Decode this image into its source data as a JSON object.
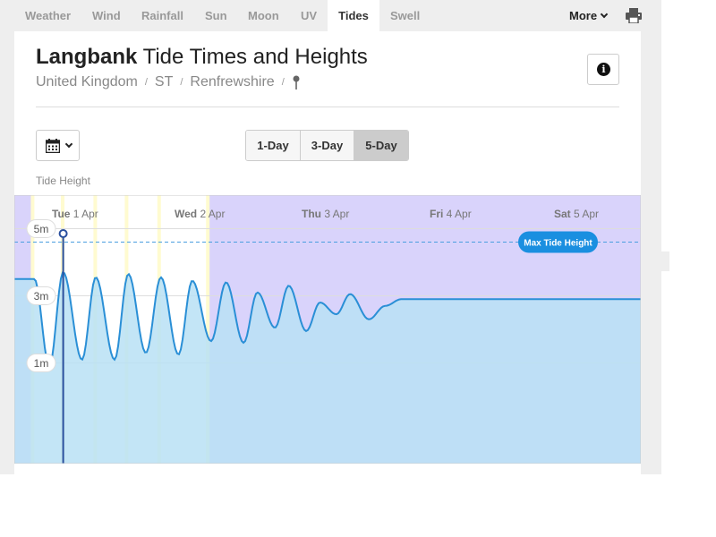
{
  "nav": {
    "tabs": [
      {
        "label": "Weather"
      },
      {
        "label": "Wind"
      },
      {
        "label": "Rainfall"
      },
      {
        "label": "Sun"
      },
      {
        "label": "Moon"
      },
      {
        "label": "UV"
      },
      {
        "label": "Tides",
        "active": true
      },
      {
        "label": "Swell"
      }
    ],
    "more_label": "More",
    "print_icon": "printer-icon"
  },
  "header": {
    "location": "Langbank",
    "title_rest": "Tide Times and Heights",
    "breadcrumb": [
      "United Kingdom",
      "ST",
      "Renfrewshire"
    ],
    "pin_icon": "map-pin-icon",
    "info_icon": "info-icon"
  },
  "controls": {
    "calendar_icon": "calendar-icon",
    "range_buttons": [
      {
        "label": "1-Day"
      },
      {
        "label": "3-Day"
      },
      {
        "label": "5-Day",
        "active": true
      }
    ]
  },
  "chart_label": "Tide Height",
  "chart_data": {
    "type": "area",
    "ylabel": "Tide Height",
    "unit": "m",
    "y_ticks": [
      "5m",
      "3m",
      "1m"
    ],
    "days": [
      {
        "weekday": "Tue",
        "date": "1 Apr"
      },
      {
        "weekday": "Wed",
        "date": "2 Apr"
      },
      {
        "weekday": "Thu",
        "date": "3 Apr"
      },
      {
        "weekday": "Fri",
        "date": "4 Apr"
      },
      {
        "weekday": "Sat",
        "date": "5 Apr"
      }
    ],
    "x_range_days": [
      -0.26,
      4.74
    ],
    "max_tide_label": "Max Tide Height",
    "max_tide_height": 4.6,
    "colors": {
      "water": "#b8e0f5",
      "line": "#2a8fd6",
      "night": "#d9d3fb",
      "twilight": "#fffbd0",
      "max_label": "#1a8fe0",
      "now_marker": "#2a4f9e"
    },
    "extremes": [
      {
        "t": -0.1,
        "h": 3.5
      },
      {
        "t": 0.02,
        "h": 0.9
      },
      {
        "t": 0.13,
        "h": 3.7
      },
      {
        "t": 0.28,
        "h": 1.1
      },
      {
        "t": 0.39,
        "h": 3.55
      },
      {
        "t": 0.54,
        "h": 1.1
      },
      {
        "t": 0.65,
        "h": 3.65
      },
      {
        "t": 0.79,
        "h": 1.3
      },
      {
        "t": 0.91,
        "h": 3.55
      },
      {
        "t": 1.05,
        "h": 1.25
      },
      {
        "t": 1.16,
        "h": 3.45
      },
      {
        "t": 1.31,
        "h": 1.65
      },
      {
        "t": 1.43,
        "h": 3.4
      },
      {
        "t": 1.57,
        "h": 1.6
      },
      {
        "t": 1.68,
        "h": 3.1
      },
      {
        "t": 1.82,
        "h": 2.05
      },
      {
        "t": 1.93,
        "h": 3.3
      },
      {
        "t": 2.07,
        "h": 1.95
      },
      {
        "t": 2.18,
        "h": 2.8
      },
      {
        "t": 2.31,
        "h": 2.45
      },
      {
        "t": 2.42,
        "h": 3.05
      },
      {
        "t": 2.57,
        "h": 2.3
      },
      {
        "t": 2.7,
        "h": 2.7
      },
      {
        "t": 2.83,
        "h": 2.9
      }
    ],
    "now_t": 0.13,
    "daylight": [
      {
        "rise": -0.1,
        "set": 0.22
      },
      {
        "rise": 0.14,
        "set": 0.49
      },
      {
        "rise": 0.4,
        "set": 0.75
      },
      {
        "rise": 0.65,
        "set": 1.01
      },
      {
        "rise": 0.91,
        "set": 1.27
      }
    ]
  }
}
